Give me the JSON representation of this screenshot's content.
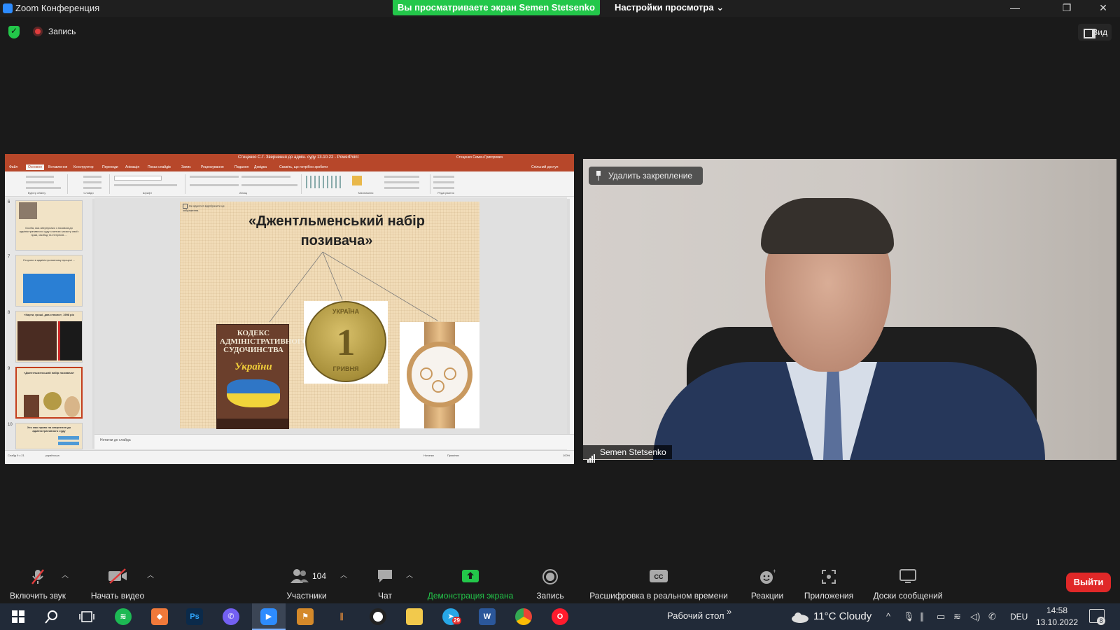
{
  "window": {
    "title": "Zoom Конференция",
    "share_banner": "Вы просматриваете экран Semen Stetsenko",
    "view_settings": "Настройки просмотра"
  },
  "status": {
    "record_label": "Запись",
    "view_label": "Вид"
  },
  "shared_screen": {
    "ppt_title": "Стеценко С.Г. Звернення до адмін. суду 13.10.22 - PowerPoint",
    "ppt_user": "Стеценко Семен Григорович",
    "tabs": [
      "Файл",
      "Основне",
      "Вставлення",
      "Конструктор",
      "Переходи",
      "Анімація",
      "Показ слайдів",
      "Запис",
      "Рецензування",
      "Подання",
      "Довідка",
      "Скажіть, що потрібно зробити",
      "Спільний доступ"
    ],
    "ribbon_groups": [
      "Буфер обміну",
      "Слайди",
      "Шрифт",
      "Абзац",
      "Малювання",
      "Редагування"
    ],
    "thumbs": [
      {
        "num": "6",
        "text": "Особа, яка звернулася з позовом до адміністративного суду з метою захисту своїх прав, свобод та інтересів ..."
      },
      {
        "num": "7",
        "text": "Сторони в адміністративному процесі ..."
      },
      {
        "num": "8",
        "text": "«Карти, гроші, два стволи», 1998 рік"
      },
      {
        "num": "9",
        "text": "«Джентльменський набір позивача»"
      },
      {
        "num": "10",
        "text": "Хто має право на звернення до адміністративного суду"
      }
    ],
    "slide": {
      "note": "Не вдалося відобразити це зображення.",
      "title": "«Джентльменський набір позивача»",
      "book_title": "КОДЕКС АДМІНІСТРАТИВНОГО СУДОЧИНСТВА",
      "book_country": "України",
      "coin_top": "УКРАЇНА",
      "coin_value": "1",
      "coin_bottom": "ГРИВНЯ"
    },
    "notes_label": "Нотатки до слайда",
    "status_left": "Слайд 9 з 21",
    "status_lang": "українська",
    "status_notes": "Нотатки",
    "status_comments": "Примітки",
    "status_zoom": "100%"
  },
  "video": {
    "unpin_label": "Удалить закрепление",
    "participant_name": "Semen Stetsenko"
  },
  "toolbar": {
    "mute": "Включить звук",
    "video": "Начать видео",
    "participants": "Участники",
    "participants_count": "104",
    "chat": "Чат",
    "share": "Демонстрация экрана",
    "record": "Запись",
    "captions": "Расшифровка в реальном времени",
    "reactions": "Реакции",
    "apps": "Приложения",
    "whiteboards": "Доски сообщений",
    "exit": "Выйти",
    "captions_icon_text": "CC"
  },
  "taskbar": {
    "desktop_label": "Рабочий стол",
    "weather": "11°C  Cloudy",
    "language": "DEU",
    "time": "14:58",
    "date": "13.10.2022",
    "telegram_badge": "29",
    "notif_badge": "8"
  },
  "colors": {
    "share_green": "#23c74a",
    "exit_red": "#e02828",
    "ppt_accent": "#b7472a",
    "taskbar": "#212a38"
  }
}
